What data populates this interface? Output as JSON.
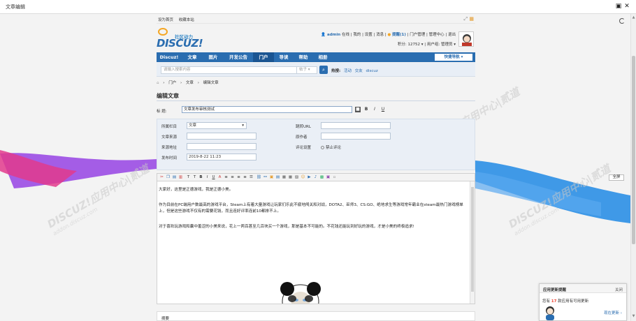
{
  "window": {
    "title": "文章编辑",
    "pin_icon": "pin-icon",
    "close_icon": "close-icon"
  },
  "topbar": {
    "links": [
      "设为首页",
      "收藏本站"
    ]
  },
  "logo": {
    "cn": "社区动力",
    "en": "DISCUZ!"
  },
  "user": {
    "name": "admin",
    "online": "在线",
    "links": [
      "我的",
      "设置",
      "消息"
    ],
    "remind": "提醒(1)",
    "admin_links": [
      "门户管理",
      "管理中心",
      "退出"
    ],
    "points": "积分: 12752",
    "group": "用户组: 管理员"
  },
  "nav": {
    "items": [
      "Discuz!",
      "文章",
      "图片",
      "开发公告",
      "门户",
      "导读",
      "帮助",
      "相册"
    ],
    "active_index": 4,
    "quick": "快捷导航"
  },
  "search": {
    "placeholder": "请输入搜索内容",
    "scope": "帖子",
    "hot_label": "热搜:",
    "hot": [
      "活动",
      "交友",
      "discuz"
    ]
  },
  "breadcrumb": [
    "门户",
    "文章",
    "编辑文章"
  ],
  "page_title": "编辑文章",
  "form": {
    "title_label": "标    题:",
    "title_value": "文章发布审核测试",
    "format_buttons": [
      "B",
      "I",
      "U"
    ],
    "category_label": "所属栏目",
    "category_value": "文章",
    "source_label": "文章来源",
    "source_url_label": "来源地址",
    "publish_time_label": "发布时间",
    "publish_time_value": "2019-8-22 11:23",
    "jump_url_label": "跳转URL",
    "author_label": "原作者",
    "comment_label": "评论设置",
    "comment_option": "禁止评论"
  },
  "editor": {
    "fullscreen": "全屏",
    "paragraphs": [
      "大家好，这里是正德游戏，我是正德小美。",
      "作为目前在PC端用户数最高的游戏平台，Steam上有着大量游戏让玩家们乐此不疲地闯关和对战，DOTA2、巫师3、CS:GO、绝地求生等游戏常年霸业在steam最热门游戏榜单上，但是这些游戏不仅有的需要花钱，而且连好评率连前10都排不上。",
      "对于喜欢玩游戏和囊中羞涩的小美来说，花上一两百甚至几百块买一个游戏，那是基本不可能的。不花钱还能玩到好玩的游戏，才是小美的终极追求!"
    ]
  },
  "abstract_label": "摘要",
  "notice": {
    "title": "应用更新提醒",
    "close": "关闭",
    "text_pre": "您有",
    "count": "17",
    "text_post": "款应用有可用更新",
    "action": "现在更新"
  },
  "watermarks": [
    {
      "text": "DISCUZ!应用中心|贰道",
      "sub": "addon.discuz.com"
    }
  ],
  "colors": {
    "primary": "#2a6db0",
    "nav_active": "#1b5592",
    "ribbon_left": "#e23a8c",
    "ribbon_right": "#2b8fe6"
  }
}
